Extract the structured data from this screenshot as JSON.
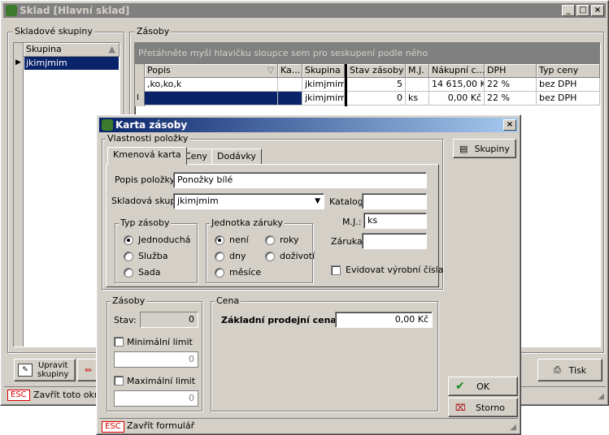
{
  "main_window": {
    "title": "Sklad [Hlavní sklad]",
    "groups_panel": {
      "title": "Skladové skupiny",
      "column_header": "Skupina",
      "rows": [
        "jkimjmim"
      ]
    },
    "stock_panel": {
      "title": "Zásoby",
      "group_hint": "Přetáhněte myší hlavičku sloupce sem pro seskupení podle něho",
      "columns": [
        "Popis",
        "Ka...",
        "Skupina",
        "Stav zásoby",
        "M.J.",
        "Nákupní c...",
        "DPH",
        "Typ ceny"
      ],
      "rows": [
        {
          "popis": ",ko,ko,k",
          "ka": "",
          "skupina": "jkimjmim",
          "stav": "5",
          "mj": "",
          "nakupni": "14 615,00 Kč",
          "dph": "22 %",
          "typ": "bez DPH"
        },
        {
          "popis": "",
          "ka": "",
          "skupina": "jkimjmim",
          "stav": "0",
          "mj": "ks",
          "nakupni": "0,00 Kč",
          "dph": "22 %",
          "typ": "bez DPH"
        }
      ]
    },
    "buttons": {
      "edit_groups": "Upravit\nskupiny",
      "print": "Tisk"
    },
    "status": {
      "esc": "ESC",
      "close_text": "Zavřít toto okno"
    }
  },
  "dialog": {
    "title": "Karta zásoby",
    "properties_title": "Vlastnosti položky",
    "tabs": [
      "Kmenová karta",
      "Ceny",
      "Dodávky"
    ],
    "fields": {
      "popis_label": "Popis položky:",
      "popis_value": "Ponožky bílé",
      "skup_label": "Skladová skup:",
      "skup_value": "jkimjmim",
      "katalog_label": "Katalog:",
      "katalog_value": "",
      "mj_label": "M.J.:",
      "mj_value": "ks",
      "zaruka_label": "Záruka:",
      "zaruka_value": ""
    },
    "typ_zasoby": {
      "title": "Typ zásoby",
      "options": [
        "Jednoduchá",
        "Služba",
        "Sada"
      ],
      "selected": "Jednoduchá"
    },
    "jednotka": {
      "title": "Jednotka záruky",
      "options": [
        "není",
        "roky",
        "dny",
        "doživotí",
        "měsíce"
      ],
      "selected": "není"
    },
    "evidovat": "Evidovat výrobní čísla",
    "zasoby": {
      "title": "Zásoby",
      "stav_label": "Stav:",
      "stav_value": "0",
      "min_label": "Minimální limit",
      "min_value": "0",
      "max_label": "Maximální limit",
      "max_value": "0"
    },
    "cena": {
      "title": "Cena",
      "label": "Základní prodejní cena:",
      "value": "0,00 Kč"
    },
    "buttons": {
      "skupiny": "Skupiny",
      "ok": "OK",
      "storno": "Storno"
    },
    "status": {
      "esc": "ESC",
      "close_text": "Zavřít formulář"
    }
  }
}
